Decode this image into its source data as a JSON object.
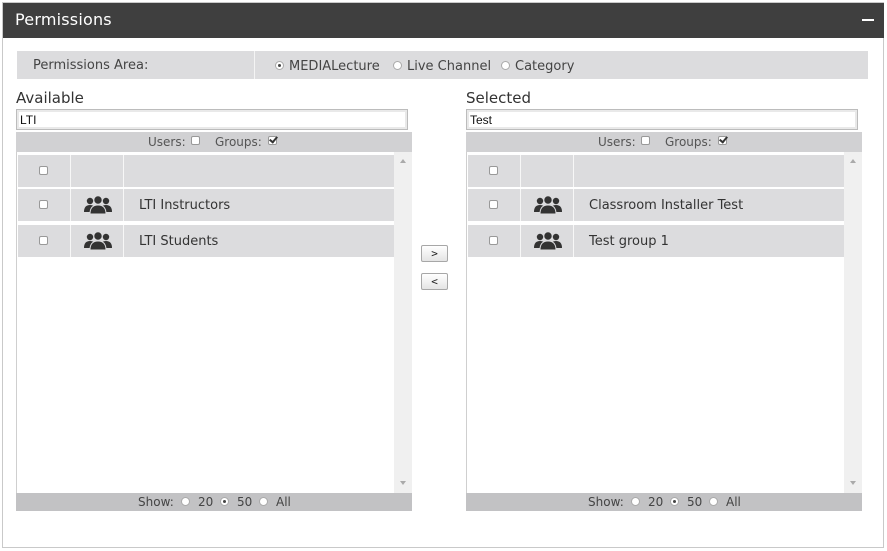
{
  "window": {
    "title": "Permissions"
  },
  "permissions_area": {
    "label": "Permissions Area:",
    "options": [
      {
        "label": "MEDIALecture",
        "selected": true
      },
      {
        "label": "Live Channel",
        "selected": false
      },
      {
        "label": "Category",
        "selected": false
      }
    ]
  },
  "available": {
    "title": "Available",
    "search_value": "LTI",
    "filter": {
      "users_label": "Users:",
      "users_checked": false,
      "groups_label": "Groups:",
      "groups_checked": true
    },
    "rows": [
      {
        "label": "LTI Instructors",
        "icon": "group-icon",
        "checked": false
      },
      {
        "label": "LTI Students",
        "icon": "group-icon",
        "checked": false
      }
    ],
    "show": {
      "label": "Show:",
      "options": [
        "20",
        "50",
        "All"
      ],
      "selected": "50"
    }
  },
  "selected": {
    "title": "Selected",
    "search_value": "Test",
    "filter": {
      "users_label": "Users:",
      "users_checked": false,
      "groups_label": "Groups:",
      "groups_checked": true
    },
    "rows": [
      {
        "label": "Classroom Installer Test",
        "icon": "group-icon",
        "checked": false
      },
      {
        "label": "Test group 1",
        "icon": "group-icon",
        "checked": false
      }
    ],
    "show": {
      "label": "Show:",
      "options": [
        "20",
        "50",
        "All"
      ],
      "selected": "50"
    }
  },
  "buttons": {
    "add_label": ">",
    "remove_label": "<"
  },
  "colors": {
    "titlebar": "#3f3f3f",
    "row": "#dcdcde",
    "filter_bar": "#d1d1d3",
    "show_bar": "#c2c2c4"
  }
}
